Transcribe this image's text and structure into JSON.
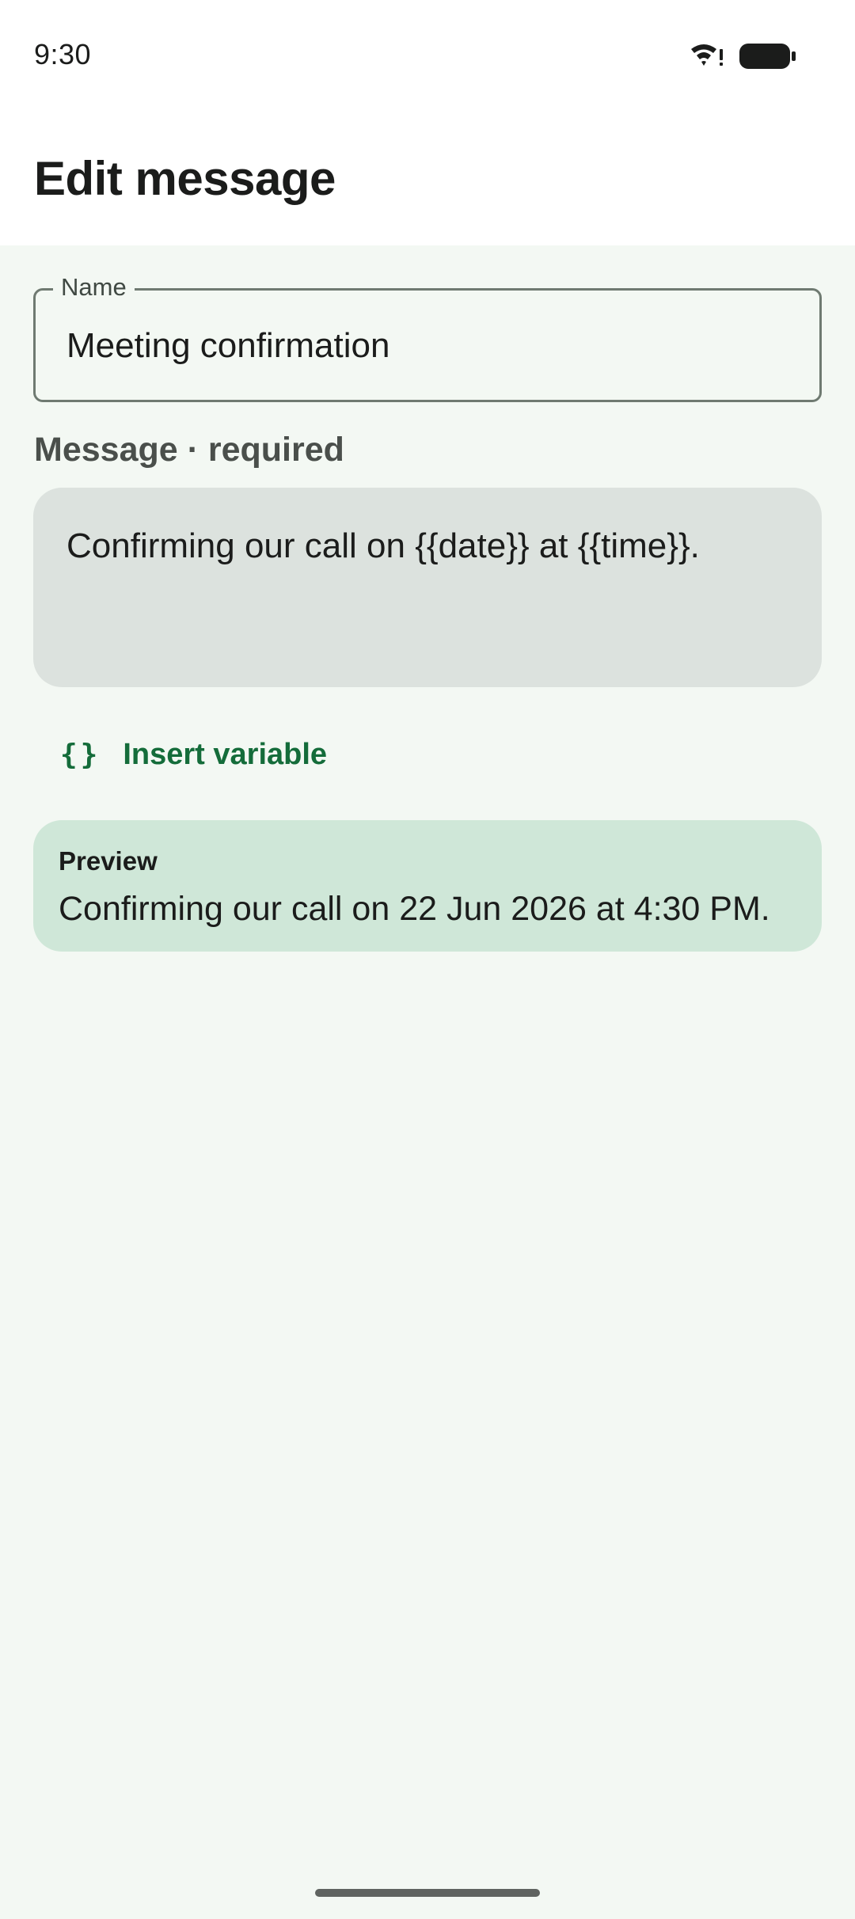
{
  "status_bar": {
    "time": "9:30",
    "wifi_icon": "wifi-alert-icon",
    "battery_icon": "battery-full-icon"
  },
  "header": {
    "title": "Edit message"
  },
  "form": {
    "name_label": "Name",
    "name_value": "Meeting confirmation",
    "message_label": "Message · required",
    "message_value": "Confirming our call on {{date}} at {{time}}.",
    "insert_icon": "braces-icon",
    "insert_icon_glyph": "{}",
    "insert_label": "Insert variable"
  },
  "preview": {
    "title": "Preview",
    "text": "Confirming our call on 22 Jun 2026 at 4:30 PM."
  },
  "colors": {
    "background": "#f3f8f3",
    "accent": "#146c3a",
    "message_box": "#dce2de",
    "preview_card": "#cfe7d8"
  }
}
